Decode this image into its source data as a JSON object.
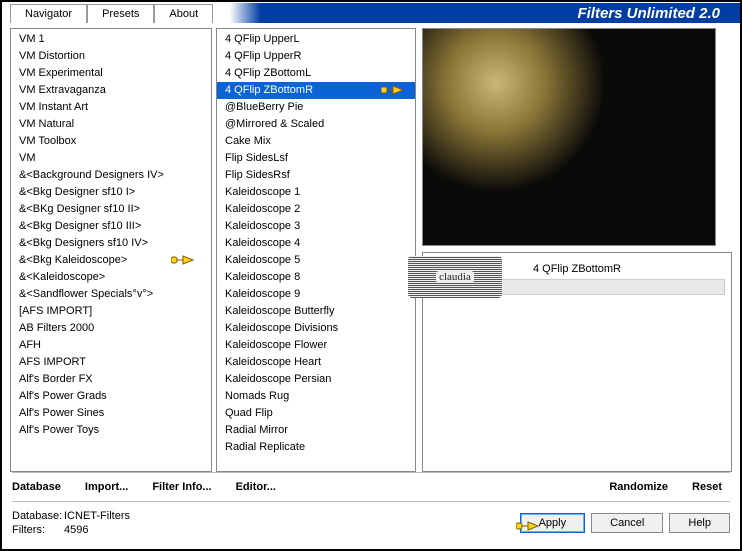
{
  "app_title": "Filters Unlimited 2.0",
  "tabs": [
    "Navigator",
    "Presets",
    "About"
  ],
  "list1": [
    "VM 1",
    "VM Distortion",
    "VM Experimental",
    "VM Extravaganza",
    "VM Instant Art",
    "VM Natural",
    "VM Toolbox",
    "VM",
    "&<Background Designers IV>",
    "&<Bkg Designer sf10 I>",
    "&<BKg Designer sf10 II>",
    "&<Bkg Designer sf10 III>",
    "&<Bkg Designers sf10 IV>",
    "&<Bkg Kaleidoscope>",
    "&<Kaleidoscope>",
    "&<Sandflower Specials°v°>",
    "[AFS IMPORT]",
    "AB Filters 2000",
    "AFH",
    "AFS IMPORT",
    "Alf's Border FX",
    "Alf's Power Grads",
    "Alf's Power Sines",
    "Alf's Power Toys"
  ],
  "list1_selected": null,
  "list1_pointer_index": 13,
  "list2": [
    "4 QFlip UpperL",
    "4 QFlip UpperR",
    "4 QFlip ZBottomL",
    "4 QFlip ZBottomR",
    "@BlueBerry Pie",
    "@Mirrored & Scaled",
    "Cake Mix",
    "Flip SidesLsf",
    "Flip SidesRsf",
    "Kaleidoscope 1",
    "Kaleidoscope 2",
    "Kaleidoscope 3",
    "Kaleidoscope 4",
    "Kaleidoscope 5",
    "Kaleidoscope 8",
    "Kaleidoscope 9",
    "Kaleidoscope Butterfly",
    "Kaleidoscope Divisions",
    "Kaleidoscope Flower",
    "Kaleidoscope Heart",
    "Kaleidoscope Persian",
    "Nomads Rug",
    "Quad Flip",
    "Radial Mirror",
    "Radial Replicate"
  ],
  "list2_selected_index": 3,
  "list2_pointer_index": 3,
  "param_title": "4 QFlip ZBottomR",
  "buttons_row1": {
    "database": "Database",
    "import": "Import...",
    "filter_info": "Filter Info...",
    "editor": "Editor...",
    "randomize": "Randomize",
    "reset": "Reset"
  },
  "footer": {
    "db_label": "Database:",
    "db_value": "ICNET-Filters",
    "filters_label": "Filters:",
    "filters_value": "4596",
    "apply": "Apply",
    "cancel": "Cancel",
    "help": "Help"
  },
  "watermark": "claudia"
}
